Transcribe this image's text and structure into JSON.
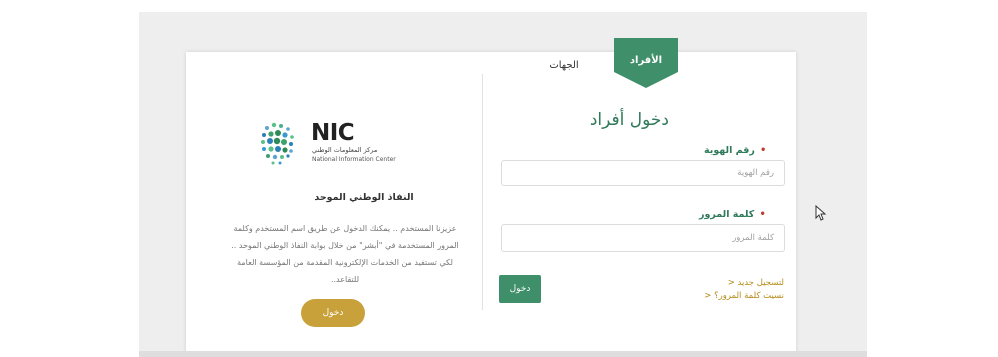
{
  "tabs": {
    "active_label": "الأفراد",
    "inactive_label": "الجهات"
  },
  "login": {
    "title": "دخول أفراد",
    "id_label": "رقم الهوية",
    "id_placeholder": "رقم الهوية",
    "password_label": "كلمة المرور",
    "password_placeholder": "كلمة المرور",
    "login_button": "دخول",
    "register_link": "> لتسجيل جديد",
    "forgot_link": "> نسيت كلمة المرور؟"
  },
  "nic": {
    "logo_text": "NIC",
    "name_ar": "مركز المعلومات الوطني",
    "name_en": "National Information Center"
  },
  "portal": {
    "title": "النفاذ الوطني الموحد",
    "description": "عزيزنا المستخدم .. يمكنك الدخول عن طريق اسم المستخدم وكلمة المرور المستخدمة في \"أبشر\" من خلال بوابة النفاذ الوطني الموحد .. لكي تستفيد من الخدمات الإلكترونية المقدمة من المؤسسة العامة للتقاعد..",
    "button": "دخول"
  },
  "colors": {
    "primary_green": "#3f8f6a",
    "title_green": "#2f7a5a",
    "gold": "#c9a13a",
    "required_red": "#c0392b"
  }
}
